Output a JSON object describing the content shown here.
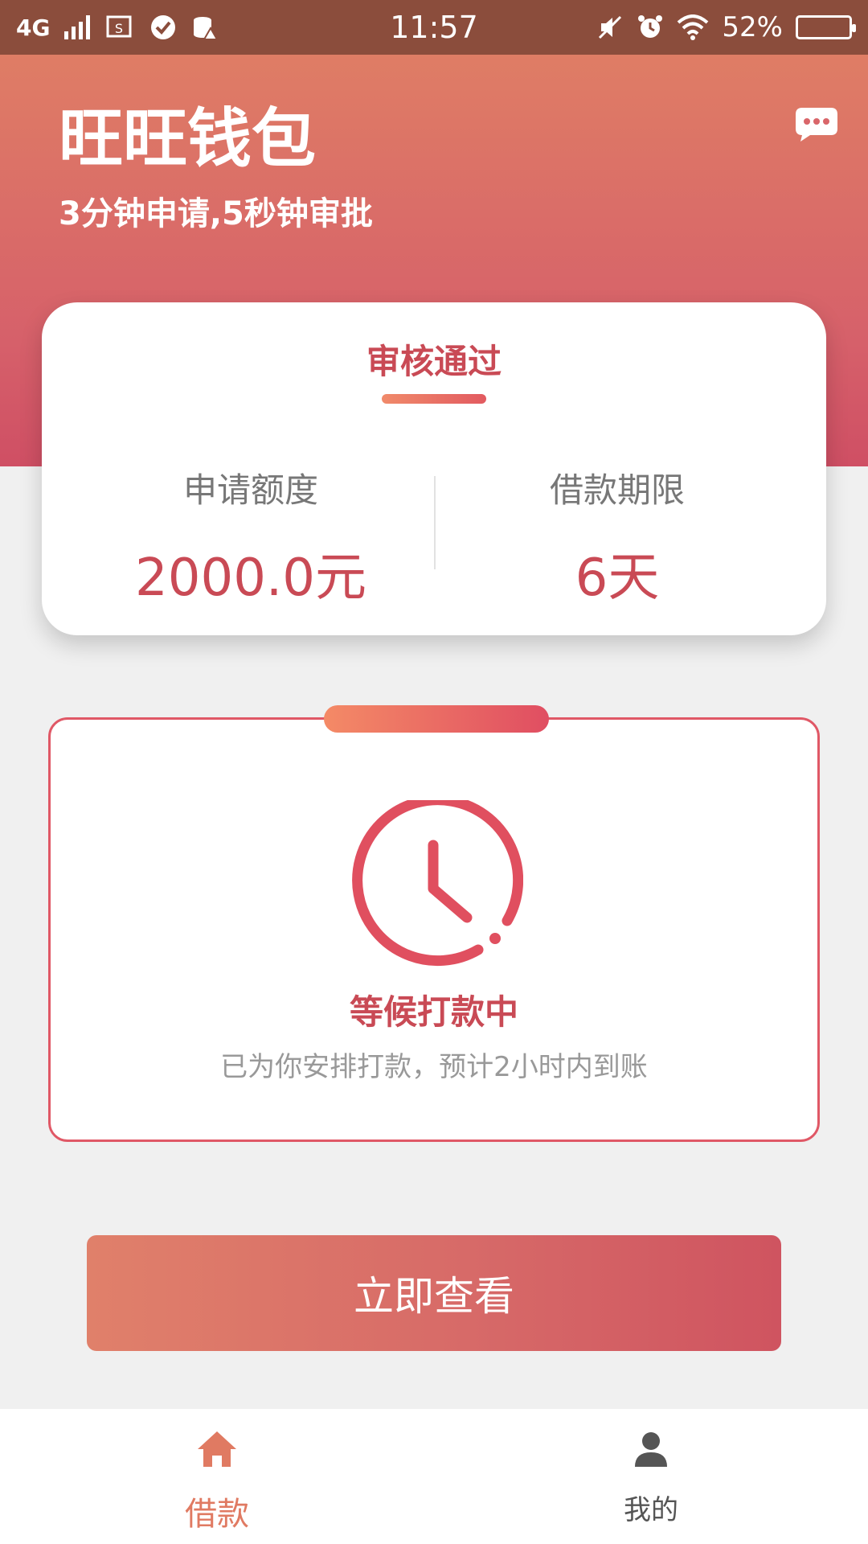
{
  "status_bar": {
    "network": "4G",
    "time": "11:57",
    "battery_percent": "52%",
    "battery_level": 0.52
  },
  "header": {
    "app_title": "旺旺钱包",
    "subtitle": "3分钟申请,5秒钟审批"
  },
  "approval_card": {
    "tab_title": "审核通过",
    "amount_label": "申请额度",
    "amount_value": "2000.0元",
    "term_label": "借款期限",
    "term_value": "6天"
  },
  "status_card": {
    "title": "等候打款中",
    "description": "已为你安排打款，预计2小时内到账"
  },
  "action": {
    "view_button": "立即查看"
  },
  "bottom_nav": {
    "items": [
      {
        "label": "借款",
        "icon": "home-icon",
        "active": true
      },
      {
        "label": "我的",
        "icon": "user-icon",
        "active": false
      }
    ]
  },
  "colors": {
    "accent": "#c94a55",
    "header_top": "#df7d65",
    "header_bottom": "#cf4f64",
    "status_bar": "#8b4d3c"
  }
}
